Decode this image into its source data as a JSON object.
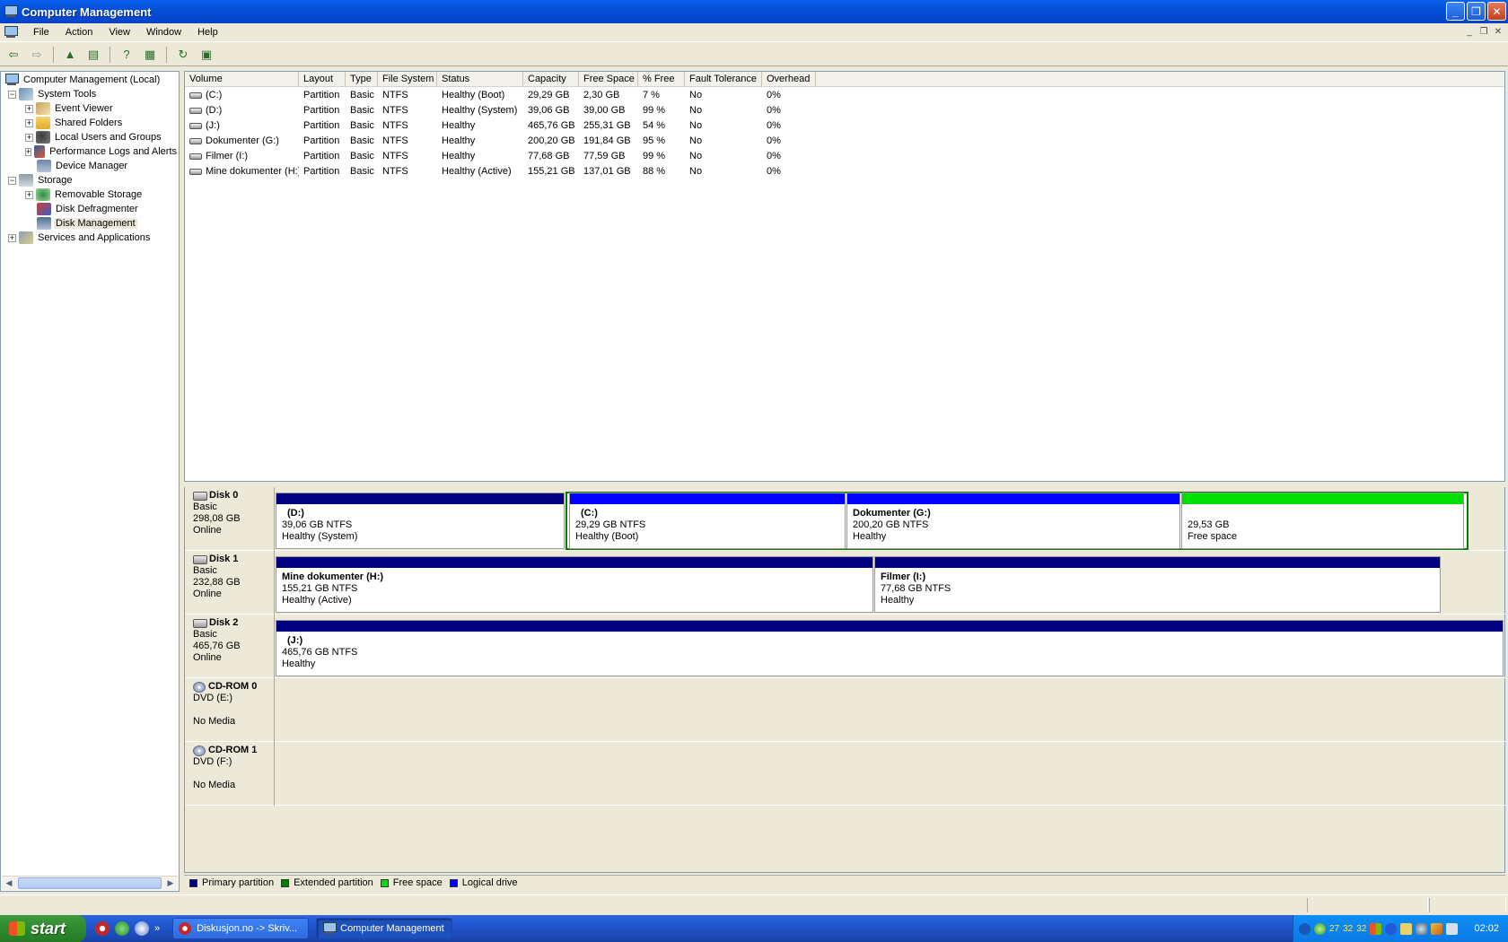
{
  "window": {
    "title": "Computer Management",
    "controls": {
      "minimize": "_",
      "restore": "❐",
      "close": "✕"
    }
  },
  "menu": [
    {
      "label": "File"
    },
    {
      "label": "Action"
    },
    {
      "label": "View"
    },
    {
      "label": "Window"
    },
    {
      "label": "Help"
    }
  ],
  "toolbar": {
    "buttons": [
      {
        "icon": "back-arrow-icon",
        "glyph": "⇦"
      },
      {
        "icon": "forward-arrow-icon",
        "glyph": "⇨"
      },
      {
        "icon": "up-folder-icon",
        "glyph": "▲"
      },
      {
        "icon": "show-hide-tree-icon",
        "glyph": "▤"
      },
      {
        "icon": "help-icon",
        "glyph": "?"
      },
      {
        "icon": "properties-icon",
        "glyph": "▦"
      },
      {
        "icon": "refresh-icon",
        "glyph": "↻"
      },
      {
        "icon": "export-icon",
        "glyph": "▣"
      }
    ]
  },
  "tree": {
    "root": "Computer Management (Local)",
    "system_tools": "System Tools",
    "event_viewer": "Event Viewer",
    "shared_folders": "Shared Folders",
    "local_users": "Local Users and Groups",
    "perf_logs": "Performance Logs and Alerts",
    "device_manager": "Device Manager",
    "storage": "Storage",
    "removable_storage": "Removable Storage",
    "disk_defragmenter": "Disk Defragmenter",
    "disk_management": "Disk Management",
    "services": "Services and Applications",
    "expand_plus": "+",
    "expand_minus": "−"
  },
  "volume_list": {
    "columns": [
      "Volume",
      "Layout",
      "Type",
      "File System",
      "Status",
      "Capacity",
      "Free Space",
      "% Free",
      "Fault Tolerance",
      "Overhead"
    ],
    "rows": [
      [
        "(C:)",
        "Partition",
        "Basic",
        "NTFS",
        "Healthy (Boot)",
        "29,29 GB",
        "2,30 GB",
        "7 %",
        "No",
        "0%"
      ],
      [
        "(D:)",
        "Partition",
        "Basic",
        "NTFS",
        "Healthy (System)",
        "39,06 GB",
        "39,00 GB",
        "99 %",
        "No",
        "0%"
      ],
      [
        "(J:)",
        "Partition",
        "Basic",
        "NTFS",
        "Healthy",
        "465,76 GB",
        "255,31 GB",
        "54 %",
        "No",
        "0%"
      ],
      [
        "Dokumenter (G:)",
        "Partition",
        "Basic",
        "NTFS",
        "Healthy",
        "200,20 GB",
        "191,84 GB",
        "95 %",
        "No",
        "0%"
      ],
      [
        "Filmer (I:)",
        "Partition",
        "Basic",
        "NTFS",
        "Healthy",
        "77,68 GB",
        "77,59 GB",
        "99 %",
        "No",
        "0%"
      ],
      [
        "Mine dokumenter (H:)",
        "Partition",
        "Basic",
        "NTFS",
        "Healthy (Active)",
        "155,21 GB",
        "137,01 GB",
        "88 %",
        "No",
        "0%"
      ]
    ]
  },
  "disks": {
    "disk0": {
      "name": "Disk 0",
      "type": "Basic",
      "size": "298,08 GB",
      "state": "Online",
      "d": {
        "title": "(D:)",
        "size": "39,06 GB NTFS",
        "status": "Healthy (System)"
      },
      "c": {
        "title": "(C:)",
        "size": "29,29 GB NTFS",
        "status": "Healthy (Boot)"
      },
      "g": {
        "title": "Dokumenter  (G:)",
        "size": "200,20 GB NTFS",
        "status": "Healthy"
      },
      "free": {
        "size": "29,53 GB",
        "status": "Free space"
      }
    },
    "disk1": {
      "name": "Disk 1",
      "type": "Basic",
      "size": "232,88 GB",
      "state": "Online",
      "h": {
        "title": "Mine dokumenter  (H:)",
        "size": "155,21 GB NTFS",
        "status": "Healthy (Active)"
      },
      "i": {
        "title": "Filmer  (I:)",
        "size": "77,68 GB NTFS",
        "status": "Healthy"
      }
    },
    "disk2": {
      "name": "Disk 2",
      "type": "Basic",
      "size": "465,76 GB",
      "state": "Online",
      "j": {
        "title": "(J:)",
        "size": "465,76 GB NTFS",
        "status": "Healthy"
      }
    },
    "cdrom0": {
      "name": "CD-ROM 0",
      "drive": "DVD (E:)",
      "media": "No Media"
    },
    "cdrom1": {
      "name": "CD-ROM 1",
      "drive": "DVD (F:)",
      "media": "No Media"
    }
  },
  "legend": {
    "primary": "Primary partition",
    "extended": "Extended partition",
    "free": "Free space",
    "logical": "Logical drive"
  },
  "colors": {
    "primary": "#000080",
    "extended": "#008000",
    "free": "#00e000",
    "logical": "#0000ff"
  },
  "taskbar": {
    "start": "start",
    "quicklaunch_more": "»",
    "tasks": [
      {
        "label": "Diskusjon.no -> Skriv..."
      },
      {
        "label": "Computer Management"
      }
    ],
    "tray_numbers": [
      "27",
      "32",
      "32"
    ],
    "clock": "02:02"
  }
}
